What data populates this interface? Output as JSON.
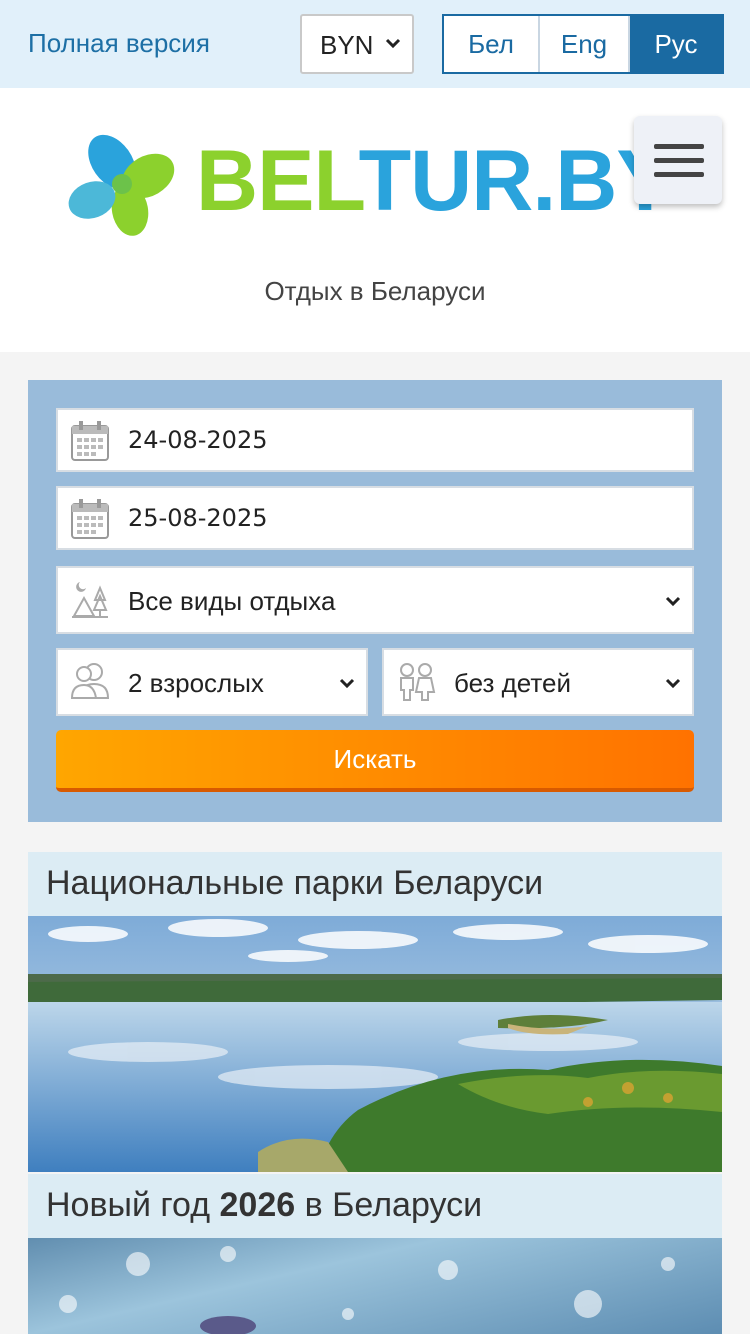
{
  "topbar": {
    "full_version": "Полная версия",
    "currency": {
      "selected": "BYN"
    },
    "languages": [
      {
        "label": "Бел",
        "active": false
      },
      {
        "label": "Eng",
        "active": false
      },
      {
        "label": "Рус",
        "active": true
      }
    ]
  },
  "header": {
    "logo_part1": "BEL",
    "logo_part2": "TUR.BY",
    "tagline": "Отдых в Беларуси"
  },
  "search": {
    "date_from": "24-08-2025",
    "date_to": "25-08-2025",
    "vacation_type": "Все виды отдыха",
    "adults": "2 взрослых",
    "children": "без детей",
    "submit_label": "Искать"
  },
  "cards": [
    {
      "title": "Национальные парки Беларуси"
    },
    {
      "title_prefix": "Новый год ",
      "title_year": "2026",
      "title_suffix": " в Беларуси"
    }
  ],
  "colors": {
    "topbar_bg": "#e1f0fa",
    "link": "#1d6fa5",
    "lang_active": "#1a6aa2",
    "search_bg": "#99bbda",
    "button_from": "#ffa600",
    "button_to": "#ff7200",
    "logo_green": "#8cd12d",
    "logo_blue": "#2aa3dc"
  }
}
